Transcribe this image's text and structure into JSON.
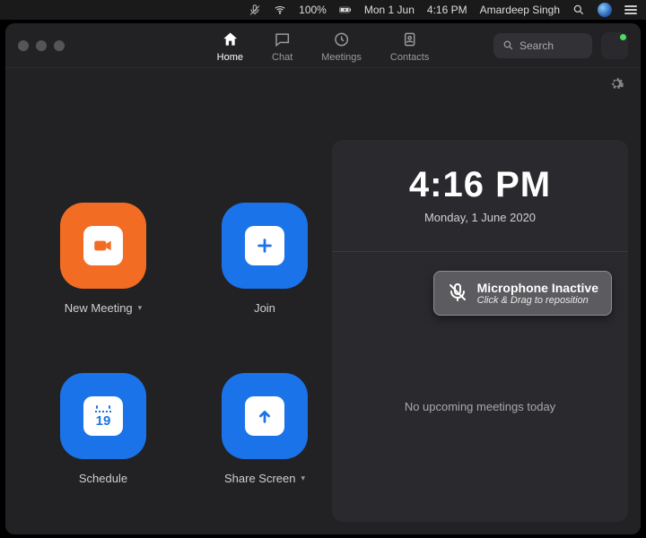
{
  "menubar": {
    "battery": "100%",
    "date": "Mon 1 Jun",
    "time": "4:16 PM",
    "user": "Amardeep Singh"
  },
  "nav": {
    "home": "Home",
    "chat": "Chat",
    "meetings": "Meetings",
    "contacts": "Contacts",
    "active": "home"
  },
  "search": {
    "placeholder": "Search"
  },
  "tiles": {
    "new_meeting": "New Meeting",
    "join": "Join",
    "schedule": "Schedule",
    "share_screen": "Share Screen",
    "calendar_day": "19"
  },
  "clock": {
    "time": "4:16 PM",
    "date": "Monday, 1 June 2020"
  },
  "toast": {
    "title": "Microphone Inactive",
    "subtitle": "Click & Drag to reposition"
  },
  "noevents": "No upcoming meetings today",
  "colors": {
    "orange": "#f26c23",
    "blue": "#1a73e8"
  }
}
